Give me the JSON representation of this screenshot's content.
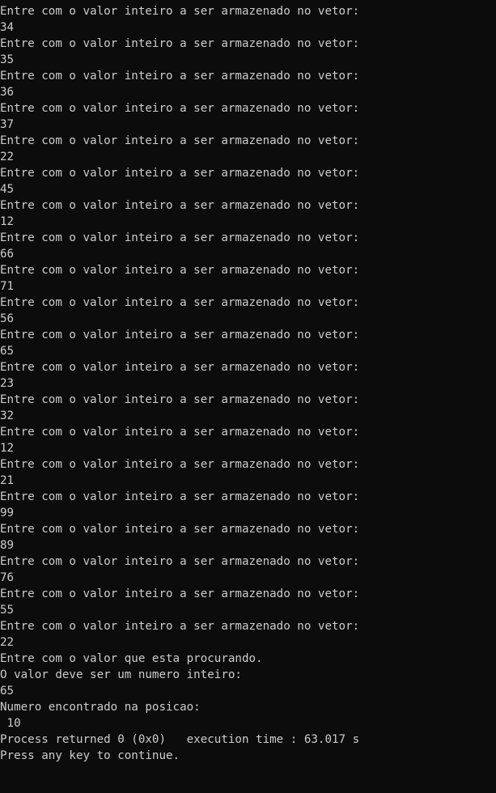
{
  "console": {
    "background_color": "#0c0c0c",
    "text_color": "#cccccc",
    "lines": [
      "Entre com o valor inteiro a ser armazenado no vetor:",
      "34",
      "Entre com o valor inteiro a ser armazenado no vetor:",
      "35",
      "Entre com o valor inteiro a ser armazenado no vetor:",
      "36",
      "Entre com o valor inteiro a ser armazenado no vetor:",
      "37",
      "Entre com o valor inteiro a ser armazenado no vetor:",
      "22",
      "Entre com o valor inteiro a ser armazenado no vetor:",
      "45",
      "Entre com o valor inteiro a ser armazenado no vetor:",
      "12",
      "Entre com o valor inteiro a ser armazenado no vetor:",
      "66",
      "Entre com o valor inteiro a ser armazenado no vetor:",
      "71",
      "Entre com o valor inteiro a ser armazenado no vetor:",
      "56",
      "Entre com o valor inteiro a ser armazenado no vetor:",
      "65",
      "Entre com o valor inteiro a ser armazenado no vetor:",
      "23",
      "Entre com o valor inteiro a ser armazenado no vetor:",
      "32",
      "Entre com o valor inteiro a ser armazenado no vetor:",
      "12",
      "Entre com o valor inteiro a ser armazenado no vetor:",
      "21",
      "Entre com o valor inteiro a ser armazenado no vetor:",
      "99",
      "Entre com o valor inteiro a ser armazenado no vetor:",
      "89",
      "Entre com o valor inteiro a ser armazenado no vetor:",
      "76",
      "Entre com o valor inteiro a ser armazenado no vetor:",
      "55",
      "Entre com o valor inteiro a ser armazenado no vetor:",
      "22",
      "Entre com o valor que esta procurando.",
      "O valor deve ser um numero inteiro:",
      "65",
      "Numero encontrado na posicao:",
      " 10",
      "Process returned 0 (0x0)   execution time : 63.017 s",
      "Press any key to continue."
    ]
  }
}
